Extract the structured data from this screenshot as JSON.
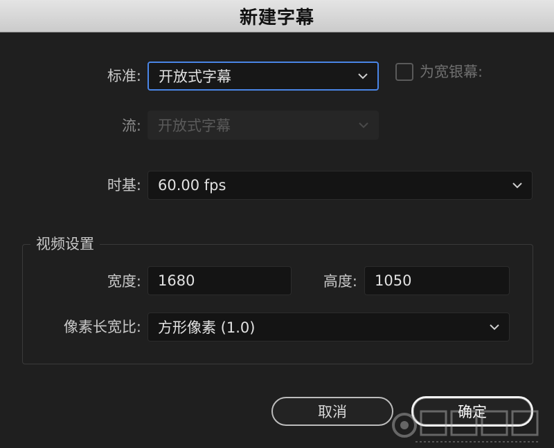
{
  "window": {
    "title": "新建字幕"
  },
  "form": {
    "standard": {
      "label": "标准:",
      "value": "开放式字幕"
    },
    "widescreen": {
      "label": "为宽银幕:",
      "checked": false
    },
    "stream": {
      "label": "流:",
      "value": "开放式字幕"
    },
    "timebase": {
      "label": "时基:",
      "value": "60.00 fps"
    }
  },
  "video_settings": {
    "title": "视频设置",
    "width": {
      "label": "宽度:",
      "value": "1680"
    },
    "height": {
      "label": "高度:",
      "value": "1050"
    },
    "pixel_aspect": {
      "label": "像素长宽比:",
      "value": "方形像素 (1.0)"
    }
  },
  "buttons": {
    "cancel": "取消",
    "ok": "确定"
  },
  "colors": {
    "accent": "#4a86e8",
    "titlebar": "#d6d6d6",
    "background": "#1f1f1f"
  },
  "icons": {
    "dropdown": "chevron-down-icon",
    "watermark": "site-watermark-logo"
  }
}
